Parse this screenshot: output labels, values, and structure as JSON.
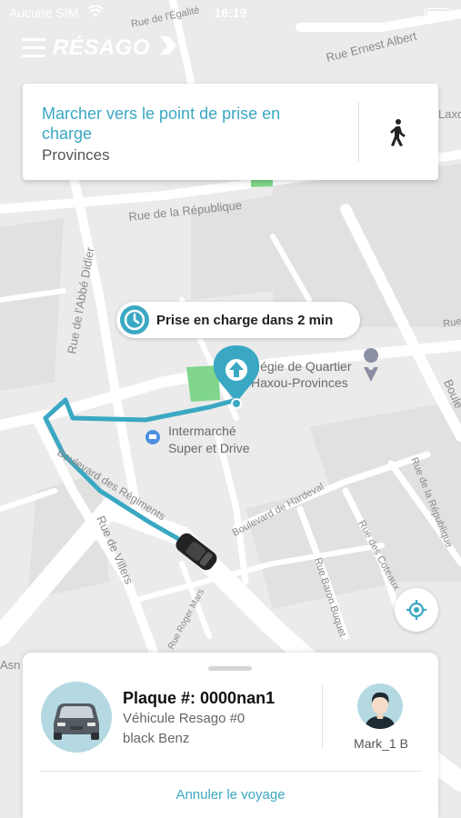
{
  "status_bar": {
    "carrier": "Aucune SIM",
    "time": "16:19"
  },
  "header": {
    "logo_text": "RÉSAGO"
  },
  "instruction": {
    "title": "Marcher vers le point de prise en charge",
    "subtitle": "Provinces",
    "icon": "walking-person-icon"
  },
  "pickup": {
    "text": "Prise en charge dans 2 min",
    "icon": "clock-icon"
  },
  "map": {
    "streets": [
      "Rue de l'Égalité",
      "Rue Ernest Albert",
      "Rue de la République",
      "Rue de l'Abbé Didier",
      "Boulevard des Régiments",
      "Rue de Villers",
      "Boulevard de Hardeval",
      "Rue Baron Buquet",
      "Rue des Coteaux",
      "Rue de la République",
      "Rue Roger Mars",
      "Boule",
      "Laxo",
      "Asn",
      "Rue"
    ],
    "pois": [
      "Régie de Quartier",
      "Haxou-Provinces",
      "Intermarché",
      "Super et Drive"
    ],
    "colors": {
      "route": "#3aa8c3",
      "park": "#80d68a",
      "map_bg": "#ebebeb"
    }
  },
  "trip": {
    "plate_label": "Plaque #: 0000nan1",
    "vehicle_name": "Véhicule Resago #0",
    "vehicle_color": "black Benz",
    "driver_name": "Mark_1 B",
    "cancel_label": "Annuler le voyage"
  },
  "colors": {
    "accent": "#3aa8c3",
    "avatar_bg": "#b5d9e2"
  }
}
